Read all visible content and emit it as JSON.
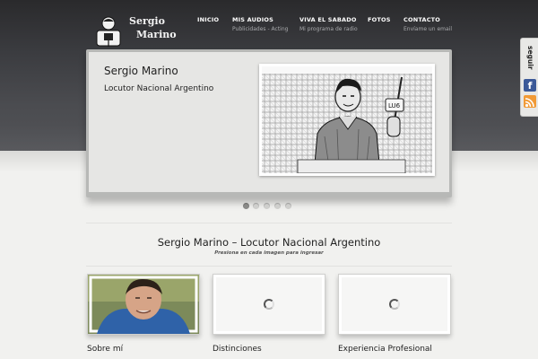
{
  "logo": {
    "line1": "Sergio",
    "line2": "Marino"
  },
  "nav": [
    {
      "label": "INICIO",
      "sub": ""
    },
    {
      "label": "MIS AUDIOS",
      "sub": "Publicidades - Acting"
    },
    {
      "label": "VIVA EL SABADO",
      "sub": "Mi programa de radio"
    },
    {
      "label": "FOTOS",
      "sub": ""
    },
    {
      "label": "CONTACTO",
      "sub": "Envíame un email"
    }
  ],
  "slider": {
    "title": "Sergio Marino",
    "subtitle": "Locutor Nacional Argentino",
    "photo_sign": "LU6",
    "dot_count": 5,
    "active_dot": 1
  },
  "section": {
    "title": "Sergio Marino – Locutor Nacional Argentino",
    "subtitle": "Presiona en cada imagen para ingresar"
  },
  "cards": [
    {
      "label": "Sobre mí"
    },
    {
      "label": "Distinciones"
    },
    {
      "label": "Experiencia Profesional"
    }
  ],
  "social": {
    "follow_label": "seguir",
    "facebook_glyph": "f"
  },
  "colors": {
    "header_dark": "#2a2a2c",
    "page_bg": "#f1f1ef",
    "facebook": "#3b5998",
    "rss": "#f19a36"
  }
}
